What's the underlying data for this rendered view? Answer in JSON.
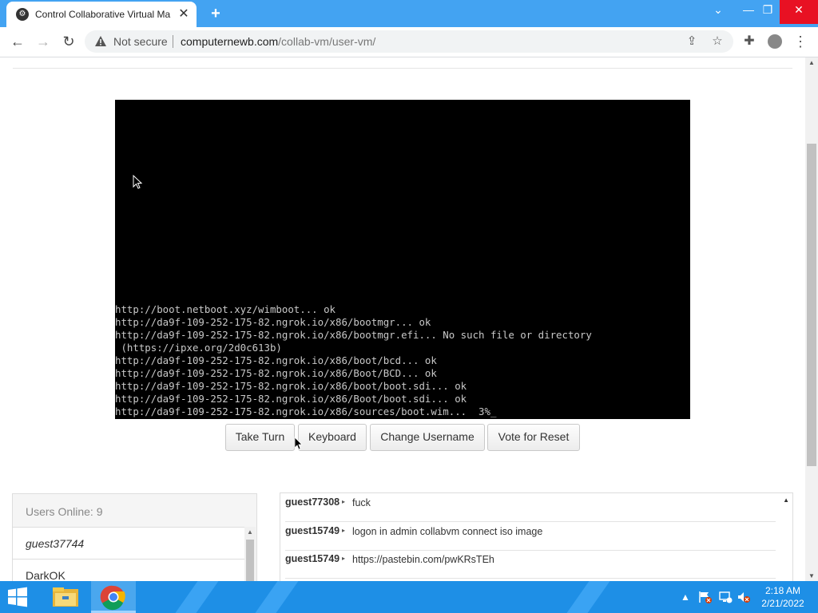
{
  "browser": {
    "tab_title": "Control Collaborative Virtual Ma",
    "security_label": "Not secure",
    "url_host": "computernewb.com",
    "url_path": "/collab-vm/user-vm/"
  },
  "vm_console": {
    "lines": [
      "http://boot.netboot.xyz/wimboot... ok",
      "http://da9f-109-252-175-82.ngrok.io/x86/bootmgr... ok",
      "http://da9f-109-252-175-82.ngrok.io/x86/bootmgr.efi... No such file or directory",
      " (https://ipxe.org/2d0c613b)",
      "http://da9f-109-252-175-82.ngrok.io/x86/boot/bcd... ok",
      "http://da9f-109-252-175-82.ngrok.io/x86/Boot/BCD... ok",
      "http://da9f-109-252-175-82.ngrok.io/x86/boot/boot.sdi... ok",
      "http://da9f-109-252-175-82.ngrok.io/x86/Boot/boot.sdi... ok",
      "http://da9f-109-252-175-82.ngrok.io/x86/sources/boot.wim...  3%_"
    ]
  },
  "controls": {
    "take_turn": "Take Turn",
    "keyboard": "Keyboard",
    "change_username": "Change Username",
    "vote_reset": "Vote for Reset"
  },
  "users": {
    "header": "Users Online: 9",
    "list": [
      "guest37744",
      "DarkOK"
    ]
  },
  "chat": {
    "messages": [
      {
        "user": "guest77308",
        "text": "fuck"
      },
      {
        "user": "guest15749",
        "text": "logon in admin collabvm connect iso image"
      },
      {
        "user": "guest15749",
        "text": "https://pastebin.com/pwKRsTEh"
      }
    ]
  },
  "taskbar": {
    "time": "2:18 AM",
    "date": "2/21/2022"
  },
  "colors": {
    "tabbar": "#43a3f2",
    "taskbar": "#1e8fe6",
    "vm_background": "#000000"
  }
}
